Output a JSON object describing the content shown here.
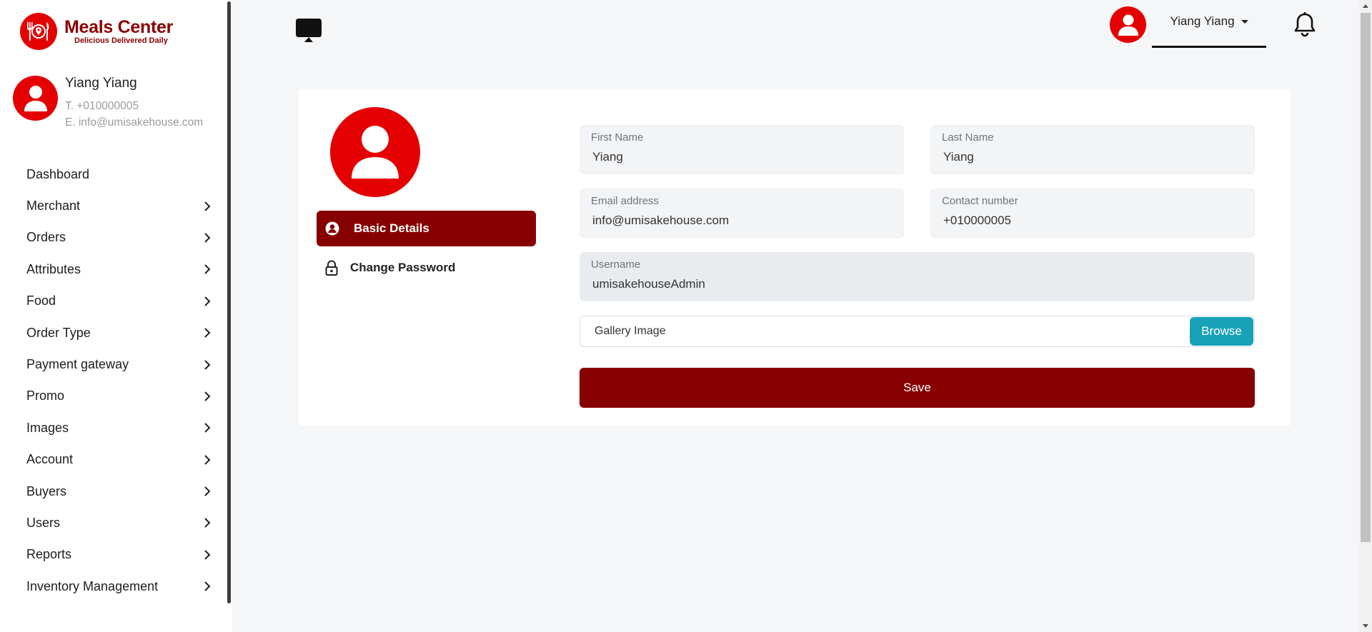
{
  "brand": {
    "name": "Meals Center",
    "tagline": "Delicious Delivered Daily",
    "accent": "#e40000",
    "dark_accent": "#870000"
  },
  "profile": {
    "name": "Yiang Yiang",
    "phone": "T. +010000005",
    "email": "E. info@umisakehouse.com"
  },
  "sidebar": {
    "items": [
      {
        "label": "Dashboard",
        "has_submenu": false
      },
      {
        "label": "Merchant",
        "has_submenu": true
      },
      {
        "label": "Orders",
        "has_submenu": true
      },
      {
        "label": "Attributes",
        "has_submenu": true
      },
      {
        "label": "Food",
        "has_submenu": true
      },
      {
        "label": "Order Type",
        "has_submenu": true
      },
      {
        "label": "Payment gateway",
        "has_submenu": true
      },
      {
        "label": "Promo",
        "has_submenu": true
      },
      {
        "label": "Images",
        "has_submenu": true
      },
      {
        "label": "Account",
        "has_submenu": true
      },
      {
        "label": "Buyers",
        "has_submenu": true
      },
      {
        "label": "Users",
        "has_submenu": true
      },
      {
        "label": "Reports",
        "has_submenu": true
      },
      {
        "label": "Inventory Management",
        "has_submenu": true
      }
    ]
  },
  "header": {
    "user_name": "Yiang Yiang",
    "icons": [
      "monitor-icon",
      "user-avatar-icon",
      "caret-down-icon",
      "bell-icon"
    ]
  },
  "tabs": {
    "basic_details": "Basic Details",
    "change_password": "Change Password"
  },
  "form": {
    "first_name": {
      "label": "First Name",
      "value": "Yiang"
    },
    "last_name": {
      "label": "Last Name",
      "value": "Yiang"
    },
    "email": {
      "label": "Email address",
      "value": "info@umisakehouse.com"
    },
    "contact": {
      "label": "Contact number",
      "value": "+010000005"
    },
    "username": {
      "label": "Username",
      "value": "umisakehouseAdmin"
    },
    "gallery": {
      "label": "Gallery Image",
      "browse": "Browse"
    },
    "save": "Save"
  }
}
